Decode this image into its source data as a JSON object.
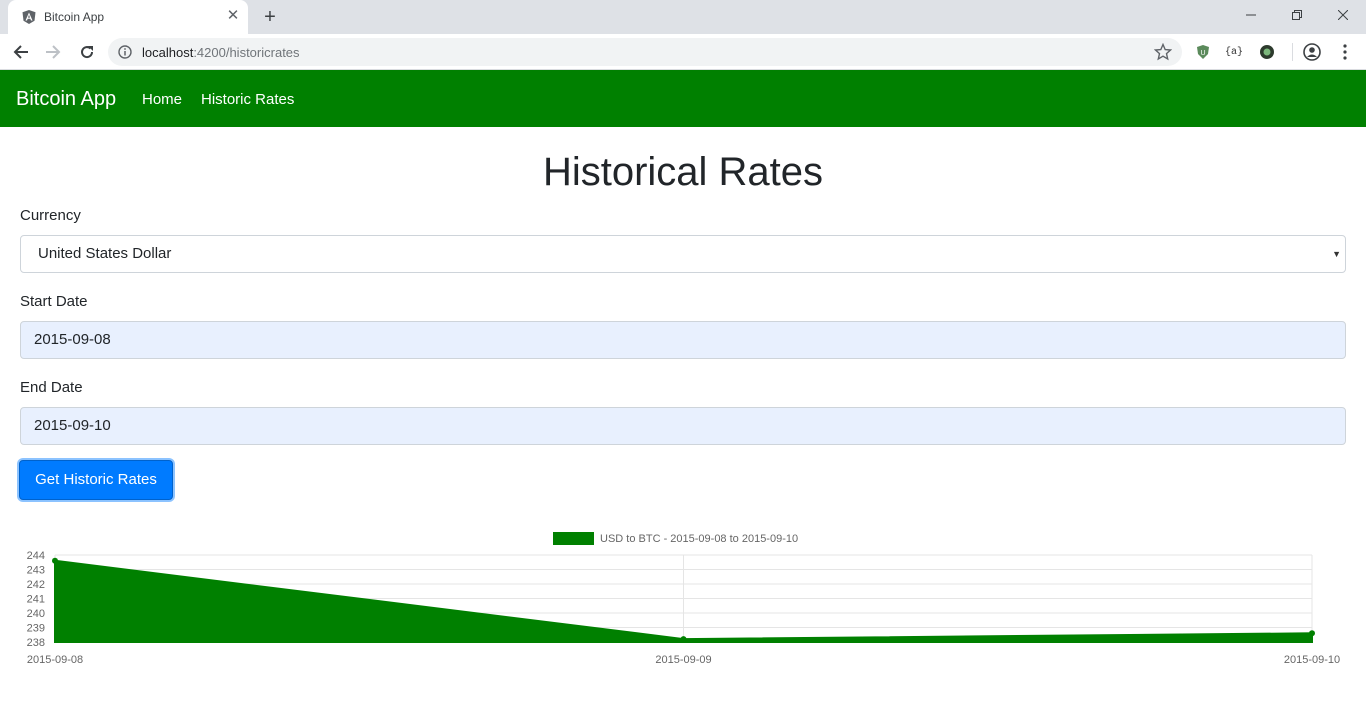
{
  "browser": {
    "tab_title": "Bitcoin App",
    "url_host": "localhost",
    "url_path": ":4200/historicrates",
    "extensions": [
      "ublock-icon",
      "json-viewer-icon",
      "extension-icon",
      "profile-icon"
    ]
  },
  "navbar": {
    "brand": "Bitcoin App",
    "links": [
      "Home",
      "Historic Rates"
    ],
    "color": "#008000"
  },
  "page": {
    "title": "Historical Rates",
    "currency_label": "Currency",
    "currency_value": "United States Dollar",
    "start_label": "Start Date",
    "start_value": "2015-09-08",
    "end_label": "End Date",
    "end_value": "2015-09-10",
    "submit_label": "Get Historic Rates",
    "button_color": "#007bff"
  },
  "chart_data": {
    "type": "area",
    "categories": [
      "2015-09-08",
      "2015-09-09",
      "2015-09-10"
    ],
    "series": [
      {
        "name": "USD to BTC - 2015-09-08 to 2015-09-10",
        "values": [
          243.6,
          238.2,
          238.6
        ],
        "color": "#008000"
      }
    ],
    "y_ticks": [
      238,
      239,
      240,
      241,
      242,
      243,
      244
    ],
    "ylim": [
      238,
      244
    ],
    "grid": true,
    "legend": "top-center"
  }
}
